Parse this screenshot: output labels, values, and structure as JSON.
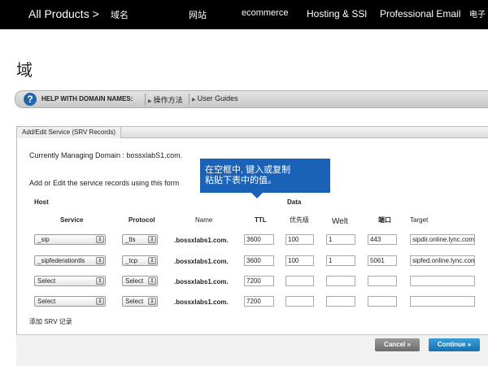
{
  "nav": {
    "all_products": "All Products >",
    "items": [
      "域名",
      "网站",
      "ecommerce",
      "Hosting & SSl",
      "Professional Email",
      "电子"
    ]
  },
  "page": {
    "title": "域"
  },
  "help": {
    "icon": "question-icon",
    "label": "HELP WITH DOMAIN NAMES:",
    "link1": "操作方法",
    "link2": "User Guides"
  },
  "panel": {
    "tab": "Add/Edit Service (SRV Records)",
    "managing": "Currently Managing Domain : bossxlabS1.com.",
    "instructions": "Add or Edit the service records using this form"
  },
  "tooltip": {
    "line1": "在空框中, 键入或复制",
    "line2": "粘贴下表中的值。"
  },
  "table": {
    "group_host": "Host",
    "group_data": "Data",
    "headers": {
      "service": "Service",
      "protocol": "Protocol",
      "name": "Name",
      "ttl": "TTL",
      "priority": "优先级",
      "weight": "Welt",
      "port": "端口",
      "target": "Target"
    },
    "rows": [
      {
        "service": "_sip",
        "protocol": "_tls",
        "name": ".bossxlabs1.com.",
        "ttl": "3600",
        "priority": "100",
        "weight": "1",
        "port": "443",
        "target": "sipdir.online.lync.com"
      },
      {
        "service": "_sipfederationtls",
        "protocol": "_tcp",
        "name": ".bossxlabs1.com.",
        "ttl": "3600",
        "priority": "100",
        "weight": "1",
        "port": "5061",
        "target": "sipfed.online.lync.com"
      },
      {
        "service": "Select",
        "protocol": "Select",
        "name": ".bossxlabs1.com.",
        "ttl": "7200",
        "priority": "",
        "weight": "",
        "port": "",
        "target": ""
      },
      {
        "service": "Select",
        "protocol": "Select",
        "name": ".bossxlabs1.com.",
        "ttl": "7200",
        "priority": "",
        "weight": "",
        "port": "",
        "target": ""
      }
    ]
  },
  "add_srv": "添加 SRV 记录",
  "buttons": {
    "cancel": "Cancel »",
    "continue": "Continue »"
  },
  "colors": {
    "nav_bg": "#000000",
    "tooltip": "#1a62b8",
    "continue": "#1670b0",
    "cancel": "#6c6c6c"
  }
}
